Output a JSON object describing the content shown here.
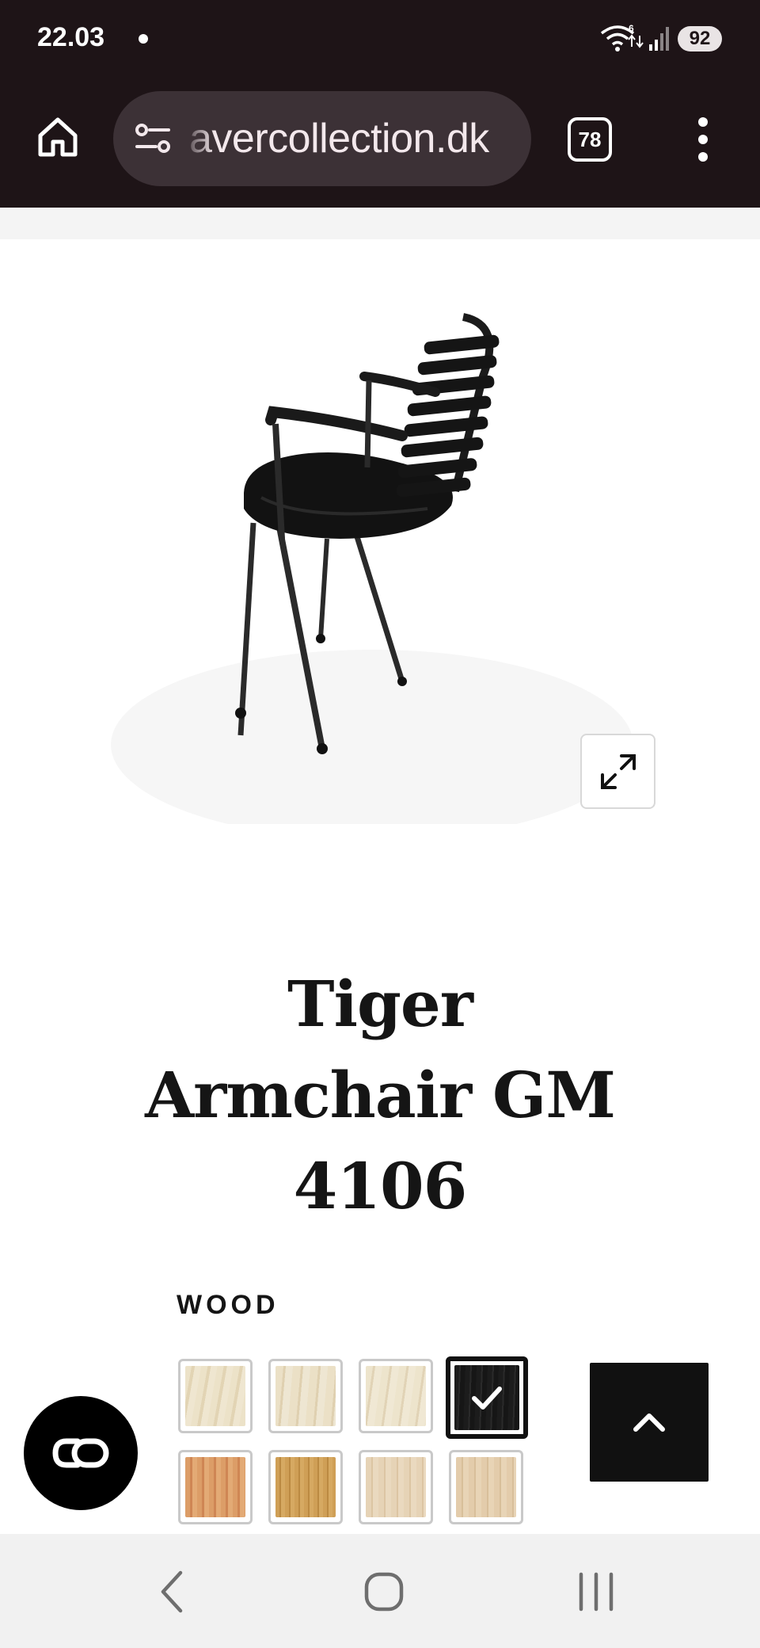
{
  "status_bar": {
    "time": "22.03",
    "battery": "92"
  },
  "browser": {
    "url_text": "avercollection.dk",
    "tab_count": "78"
  },
  "product": {
    "title_lines": [
      "Tiger",
      "Armchair GM",
      "4106"
    ]
  },
  "options": {
    "wood_label": "WOOD",
    "swatches": [
      {
        "name": "white-maple",
        "color": "#e8dcc0",
        "selected": false
      },
      {
        "name": "white-maple-2",
        "color": "#e6d9c0",
        "selected": false
      },
      {
        "name": "white-maple-3",
        "color": "#e9dec6",
        "selected": false
      },
      {
        "name": "black",
        "color": "#1a1a1a",
        "selected": true
      },
      {
        "name": "cherry",
        "color": "#d99a63",
        "selected": false
      },
      {
        "name": "oak",
        "color": "#c99a52",
        "selected": false
      },
      {
        "name": "ash",
        "color": "#e3cfb0",
        "selected": false
      },
      {
        "name": "beech",
        "color": "#e0c8a6",
        "selected": false
      }
    ]
  },
  "colors": {
    "chrome": "#1e1417",
    "url_pill": "#3c3136",
    "accent_dark": "#111111"
  }
}
